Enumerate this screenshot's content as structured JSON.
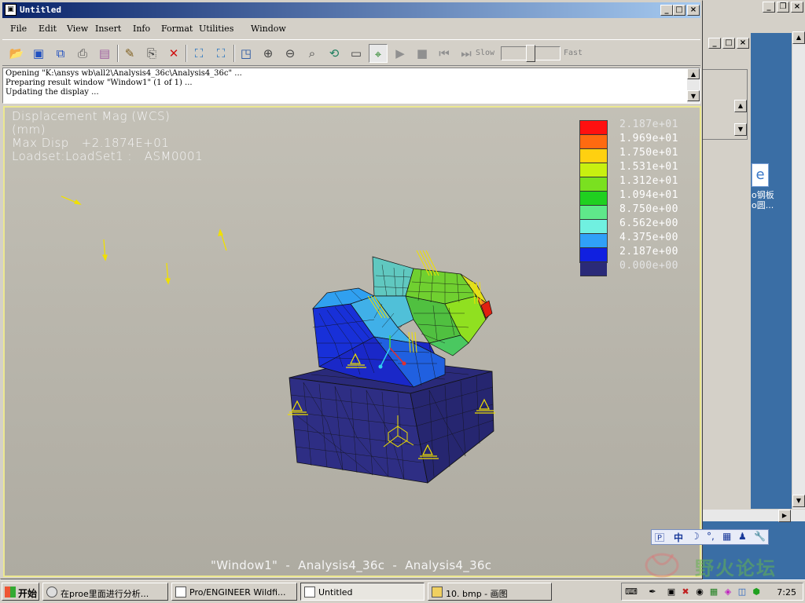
{
  "window": {
    "title": "Untitled",
    "controls": [
      "_",
      "□",
      "×"
    ]
  },
  "menu": [
    "File",
    "Edit",
    "View",
    "Insert",
    "Info",
    "Format",
    "Utilities",
    "Window"
  ],
  "toolbar": {
    "speed_slow": "Slow",
    "speed_fast": "Fast",
    "speed_level": 0.5
  },
  "messages": [
    "Opening \"K:\\ansys wb\\all2\\Analysis4_36c\\Analysis4_36c\" ...",
    "Preparing result window \"Window1\" (1 of 1) ...",
    "Updating the display ..."
  ],
  "viewport": {
    "result_label": "Displacement Mag (WCS)",
    "units": "(mm)",
    "max_disp": "Max Disp   +2.1874E+01",
    "loadset": "Loadset:LoadSet1 :   ASM0001",
    "footer": "\"Window1\"  -  Analysis4_36c  -  Analysis4_36c"
  },
  "legend": {
    "values": [
      "2.187e+01",
      "1.969e+01",
      "1.750e+01",
      "1.531e+01",
      "1.312e+01",
      "1.094e+01",
      "8.750e+00",
      "6.562e+00",
      "4.375e+00",
      "2.187e+00",
      "0.000e+00"
    ],
    "colors": [
      "#ff1010",
      "#ff6a10",
      "#ffd010",
      "#c8f010",
      "#7ae020",
      "#20d020",
      "#5fe88a",
      "#70f0e0",
      "#30a0f8",
      "#1020e0",
      "#2a2a78"
    ]
  },
  "desktop_icon": {
    "label_line1": "o钢板",
    "label_line2": "o圆..."
  },
  "ime": {
    "items": [
      "中",
      "☽",
      "°,",
      "▦",
      "♟",
      "🔧"
    ]
  },
  "watermark": {
    "text": "野火论坛"
  },
  "taskbar": {
    "start": "开始",
    "tasks": [
      {
        "label": "在proe里面进行分析..."
      },
      {
        "label": "Pro/ENGINEER Wildfi..."
      },
      {
        "label": "Untitled"
      },
      {
        "label": "10. bmp - 画图"
      }
    ],
    "clock": "7:25"
  }
}
